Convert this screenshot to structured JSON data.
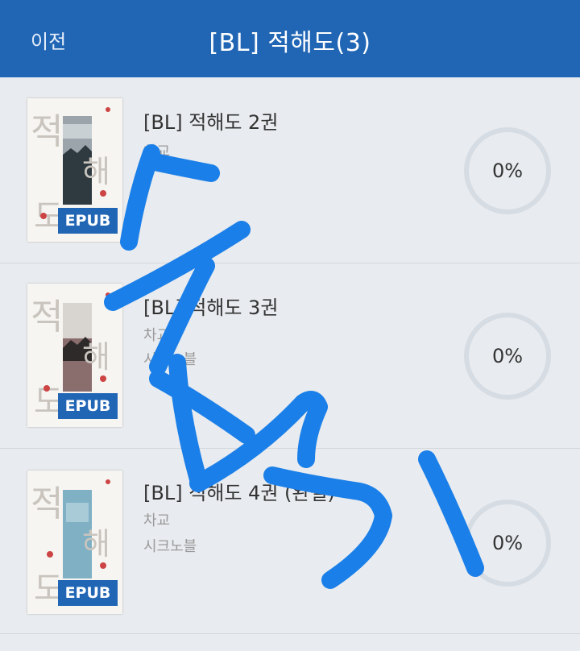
{
  "header": {
    "back_label": "이전",
    "title": "[BL] 적해도(3)"
  },
  "books": [
    {
      "title": "[BL] 적해도 2권",
      "author": "차교",
      "publisher": "",
      "format": "EPUB",
      "progress_percent": 0,
      "progress_label": "0%",
      "cover_band_color": "#9aa4aa",
      "cover_title_glyphs": [
        "적",
        "해",
        "도"
      ]
    },
    {
      "title": "[BL] 적해도 3권",
      "author": "차교",
      "publisher": "시크노블",
      "format": "EPUB",
      "progress_percent": 0,
      "progress_label": "0%",
      "cover_band_color": "#8a6e6e",
      "cover_title_glyphs": [
        "적",
        "해",
        "도"
      ]
    },
    {
      "title": "[BL] 적해도 4권 (완결)",
      "author": "차교",
      "publisher": "시크노블",
      "format": "EPUB",
      "progress_percent": 0,
      "progress_label": "0%",
      "cover_band_color": "#7fb0c4",
      "cover_title_glyphs": [
        "적",
        "해",
        "도"
      ]
    }
  ],
  "colors": {
    "header_bg": "#2166b5",
    "scribble": "#1a7fe8",
    "progress_ring": "#d6dce3"
  }
}
